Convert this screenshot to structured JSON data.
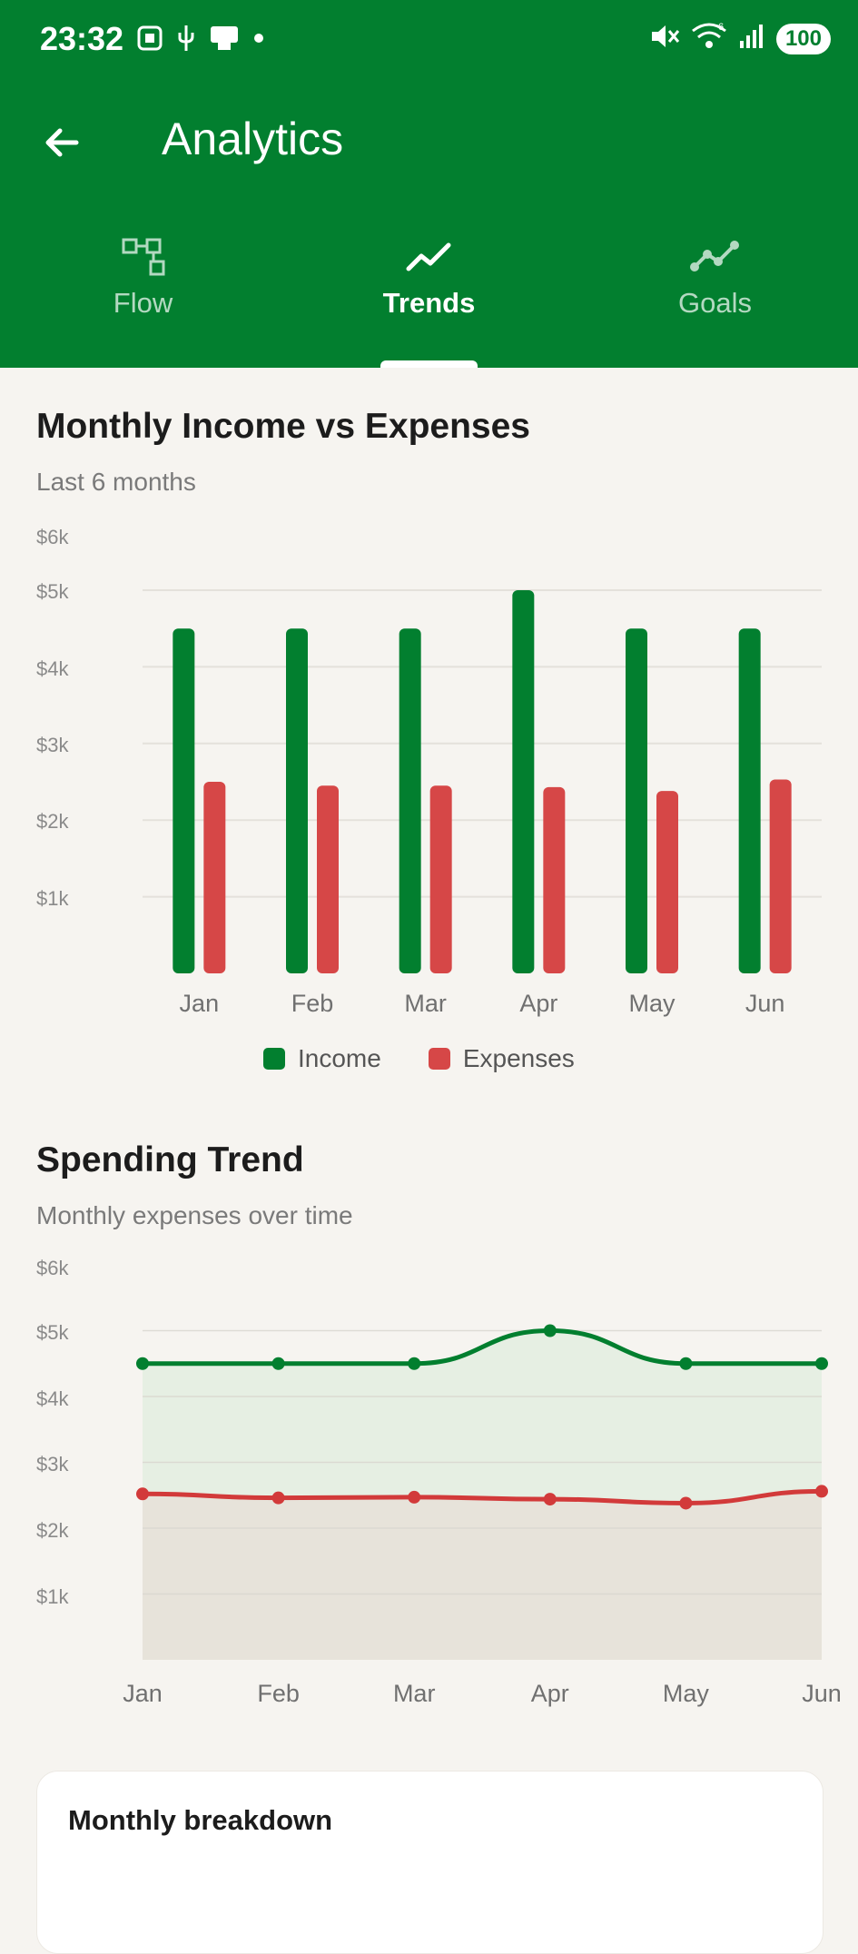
{
  "status_bar": {
    "time": "23:32",
    "battery": "100",
    "wifi_badge": "6",
    "icons": [
      "screenshot-icon",
      "usb-icon",
      "sim-icon",
      "dot-icon",
      "mute-icon",
      "wifi-icon",
      "signal-icon",
      "battery-icon"
    ]
  },
  "app_bar": {
    "title": "Analytics",
    "back_icon": "arrow-left-icon"
  },
  "tabs": [
    {
      "label": "Flow",
      "icon": "flow-icon",
      "active": false
    },
    {
      "label": "Trends",
      "icon": "trend-icon",
      "active": true
    },
    {
      "label": "Goals",
      "icon": "goals-icon",
      "active": false
    }
  ],
  "colors": {
    "brand": "#027f2f",
    "income": "#027f2f",
    "expenses": "#d64747",
    "background": "#f6f4f0"
  },
  "income_vs_expenses": {
    "title": "Monthly Income vs Expenses",
    "subtitle": "Last 6 months",
    "y_ticks": [
      "$6k",
      "$5k",
      "$4k",
      "$3k",
      "$2k",
      "$1k"
    ],
    "legend": [
      {
        "label": "Income",
        "color": "#027f2f"
      },
      {
        "label": "Expenses",
        "color": "#d64747"
      }
    ]
  },
  "spending_trend": {
    "title": "Spending Trend",
    "subtitle": "Monthly expenses over time",
    "y_ticks": [
      "$6k",
      "$5k",
      "$4k",
      "$3k",
      "$2k",
      "$1k"
    ]
  },
  "breakdown": {
    "title": "Monthly breakdown"
  },
  "chart_data": [
    {
      "type": "bar",
      "categories": [
        "Jan",
        "Feb",
        "Mar",
        "Apr",
        "May",
        "Jun"
      ],
      "series": [
        {
          "name": "Income",
          "values": [
            4500,
            4500,
            4500,
            5000,
            4500,
            4500
          ]
        },
        {
          "name": "Expenses",
          "values": [
            2500,
            2450,
            2450,
            2430,
            2380,
            2530
          ]
        }
      ],
      "title": "Monthly Income vs Expenses",
      "ylim": [
        0,
        6000
      ],
      "grid": true,
      "legend": "bottom"
    },
    {
      "type": "area",
      "categories": [
        "Jan",
        "Feb",
        "Mar",
        "Apr",
        "May",
        "Jun"
      ],
      "series": [
        {
          "values": [
            4500,
            4500,
            4500,
            5000,
            4500,
            4500
          ]
        },
        {
          "values": [
            2520,
            2460,
            2470,
            2440,
            2380,
            2560
          ]
        }
      ],
      "title": "Spending Trend",
      "ylim": [
        0,
        6000
      ],
      "grid": true
    }
  ]
}
